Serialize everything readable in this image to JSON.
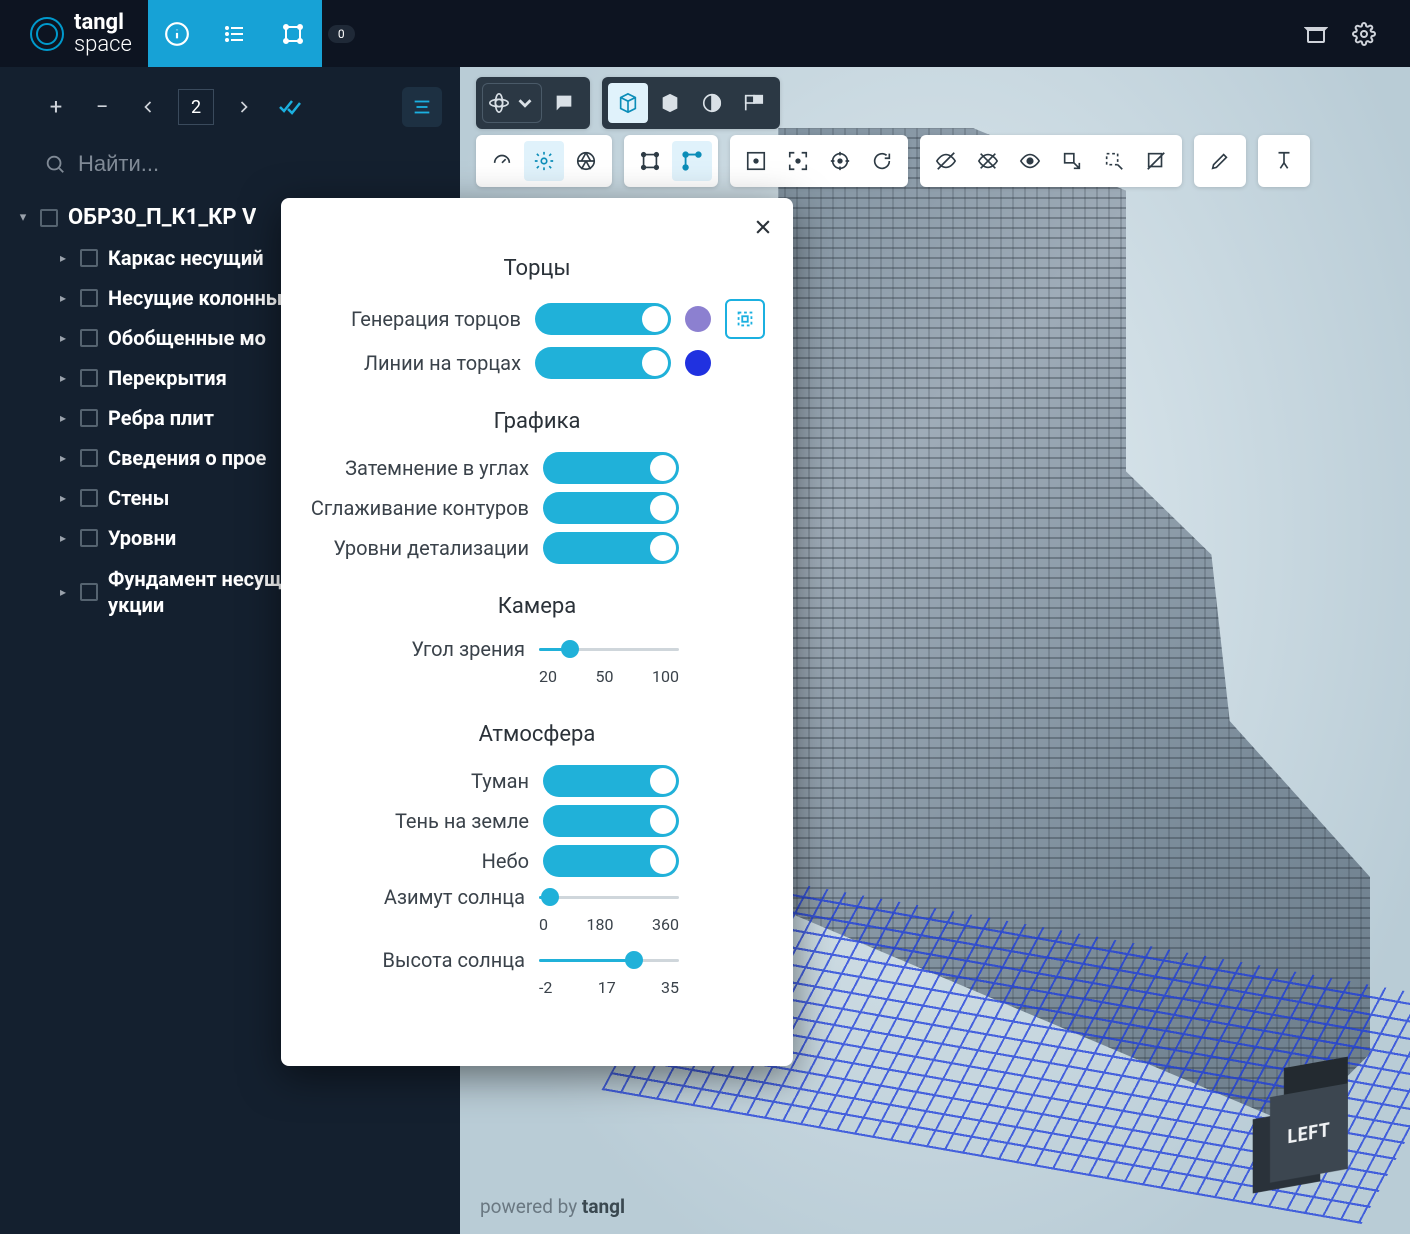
{
  "app": {
    "brand_top": "tangl",
    "brand_bottom": "space",
    "badge": "0"
  },
  "sidebar": {
    "page": "2",
    "search_placeholder": "Найти...",
    "root_label": "ОБР30_П_К1_КР V",
    "items": [
      {
        "label": "Каркас несущий"
      },
      {
        "label": "Несущие колонны"
      },
      {
        "label": "Обобщенные мо"
      },
      {
        "label": "Перекрытия"
      },
      {
        "label": "Ребра плит"
      },
      {
        "label": "Сведения о прое"
      },
      {
        "label": "Стены"
      },
      {
        "label": "Уровни"
      },
      {
        "label": "Фундамент несущий укции"
      }
    ]
  },
  "viewport": {
    "powered_prefix": "powered by ",
    "powered_brand": "tangl",
    "navcube_left": "LEFT"
  },
  "modal": {
    "sections": {
      "ends": {
        "title": "Торцы",
        "gen_label": "Генерация торцов",
        "lines_label": "Линии на торцах"
      },
      "graphics": {
        "title": "Графика",
        "corner_shade": "Затемнение в углах",
        "contour_smooth": "Сглаживание контуров",
        "lod": "Уровни детализации"
      },
      "camera": {
        "title": "Камера",
        "fov_label": "Угол зрения",
        "fov_ticks": [
          "20",
          "50",
          "100"
        ]
      },
      "atmosphere": {
        "title": "Атмосфера",
        "fog": "Туман",
        "ground_shadow": "Тень на земле",
        "sky": "Небо",
        "sun_az_label": "Азимут солнца",
        "sun_az_ticks": [
          "0",
          "180",
          "360"
        ],
        "sun_alt_label": "Высота солнца",
        "sun_alt_ticks": [
          "-2",
          "17",
          "35"
        ]
      }
    }
  },
  "colors": {
    "accent": "#20b1d9",
    "purple": "#8c80d0",
    "blue": "#2031e0"
  }
}
